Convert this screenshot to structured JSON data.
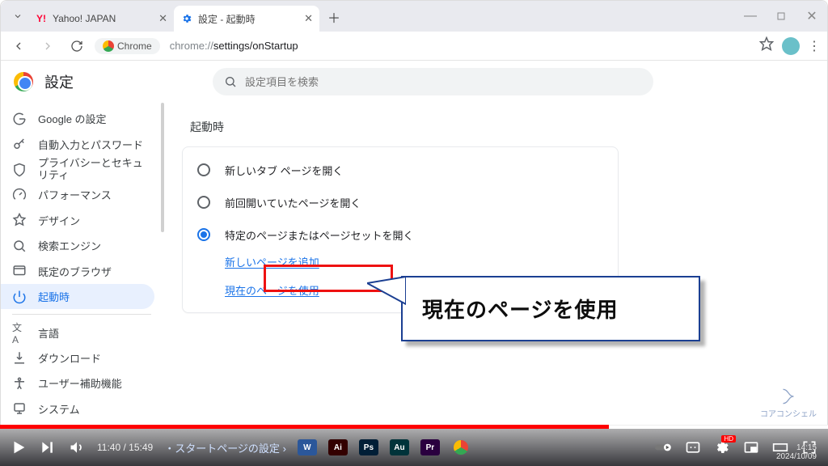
{
  "tabs": [
    {
      "label": "Yahoo! JAPAN"
    },
    {
      "label": "設定 - 起動時"
    }
  ],
  "url": {
    "chip": "Chrome",
    "path": "chrome://settings/onStartup",
    "gray": "chrome://"
  },
  "settings": {
    "title": "設定",
    "search_placeholder": "設定項目を検索",
    "sidebar": {
      "items": [
        {
          "label": "Google の設定"
        },
        {
          "label": "自動入力とパスワード"
        },
        {
          "label": "プライバシーとセキュリティ"
        },
        {
          "label": "パフォーマンス"
        },
        {
          "label": "デザイン"
        },
        {
          "label": "検索エンジン"
        },
        {
          "label": "既定のブラウザ"
        },
        {
          "label": "起動時"
        }
      ],
      "items2": [
        {
          "label": "言語"
        },
        {
          "label": "ダウンロード"
        },
        {
          "label": "ユーザー補助機能"
        },
        {
          "label": "システム"
        }
      ]
    },
    "section_title": "起動時",
    "options": [
      {
        "label": "新しいタブ ページを開く",
        "checked": false
      },
      {
        "label": "前回開いていたページを開く",
        "checked": false
      },
      {
        "label": "特定のページまたはページセットを開く",
        "checked": true
      }
    ],
    "links": {
      "add": "新しいページを追加",
      "use_current": "現在のページを使用"
    }
  },
  "callout": "現在のページを使用",
  "video": {
    "time_current": "11:40",
    "time_total": "15:49",
    "chapter": "・スタートページの設定",
    "arrow": "›"
  },
  "watermark": "コアコンシェル",
  "clock": {
    "time": "14:15",
    "date": "2024/10/09"
  }
}
